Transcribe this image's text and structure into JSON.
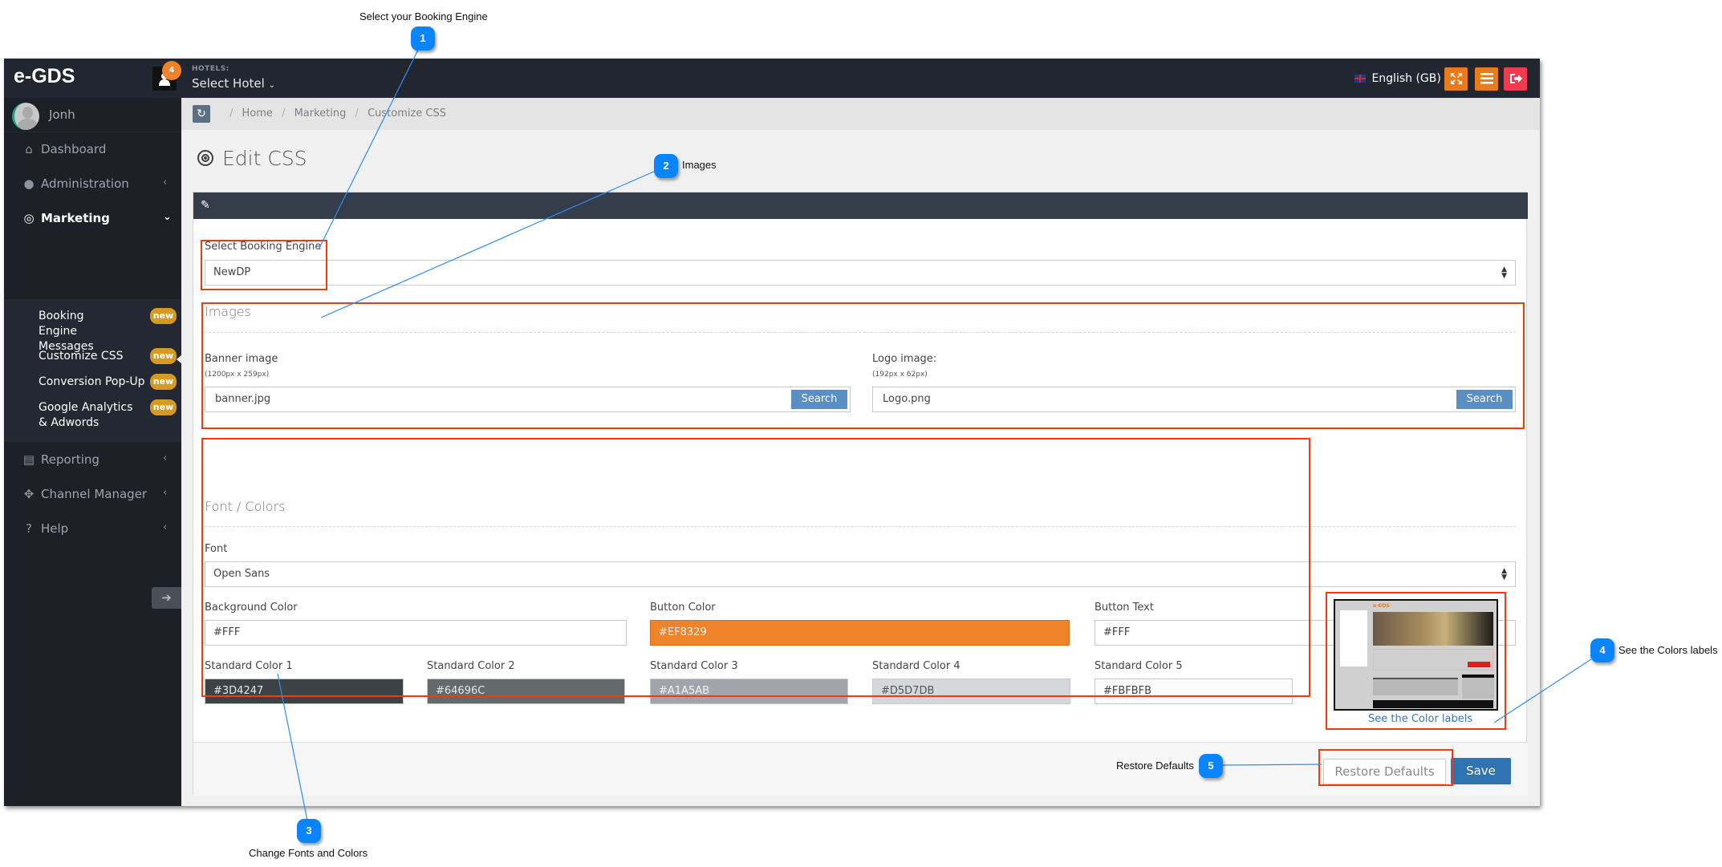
{
  "app": {
    "brand": "e-GDS",
    "notification_count": "4",
    "hotels_label": "HOTELS:",
    "hotel_select": "Select Hotel",
    "language": "English (GB)",
    "icons": {
      "fullscreen": "fullscreen-icon",
      "menu": "hamburger-icon",
      "logout": "logout-icon"
    }
  },
  "sidebar": {
    "username": "Jonh",
    "items": [
      {
        "label": "Dashboard",
        "icon": "home-icon",
        "arrow": ""
      },
      {
        "label": "Administration",
        "icon": "user-icon",
        "arrow": "‹"
      },
      {
        "label": "Marketing",
        "icon": "target-icon",
        "arrow": "⌄",
        "active": true
      },
      {
        "label": "Reporting",
        "icon": "bar-chart-icon",
        "arrow": "‹"
      },
      {
        "label": "Channel Manager",
        "icon": "move-icon",
        "arrow": "‹"
      },
      {
        "label": "Help",
        "icon": "question-icon",
        "arrow": "‹"
      }
    ],
    "submenu": [
      {
        "label": "Booking Engine Messages",
        "badge": "new"
      },
      {
        "label": "Customize CSS",
        "badge": "new",
        "active": true
      },
      {
        "label": "Conversion Pop-Up",
        "badge": "new"
      },
      {
        "label": "Google Analytics & Adwords",
        "badge": "new"
      }
    ]
  },
  "breadcrumb": [
    "Home",
    "Marketing",
    "Customize CSS"
  ],
  "page": {
    "title": "Edit CSS",
    "booking_engine": {
      "label": "Select Booking Engine",
      "value": "NewDP"
    },
    "images": {
      "title": "Images",
      "banner": {
        "label": "Banner image",
        "hint": "(1200px x 259px)",
        "value": "banner.jpg",
        "button": "Search"
      },
      "logo": {
        "label": "Logo image:",
        "hint": "(192px x 62px)",
        "value": "Logo.png",
        "button": "Search"
      }
    },
    "fonts": {
      "title": "Font / Colors",
      "font_label": "Font",
      "font_value": "Open Sans",
      "background": {
        "label": "Background Color",
        "value": "#FFF",
        "swatch": "#ffffff"
      },
      "button_color": {
        "label": "Button Color",
        "value": "#EF8329",
        "swatch": "#ef8329"
      },
      "button_text": {
        "label": "Button Text",
        "value": "#FFF",
        "swatch": "#ffffff"
      },
      "standard": [
        {
          "label": "Standard Color 1",
          "value": "#3D4247",
          "swatch": "#3d4247"
        },
        {
          "label": "Standard Color 2",
          "value": "#64696C",
          "swatch": "#64696c"
        },
        {
          "label": "Standard Color 3",
          "value": "#A1A5AB",
          "swatch": "#a1a5ab"
        },
        {
          "label": "Standard Color 4",
          "value": "#D5D7DB",
          "swatch": "#d5d7db"
        },
        {
          "label": "Standard Color 5",
          "value": "#FBFBFB",
          "swatch": "#fbfbfb"
        }
      ]
    },
    "color_labels_link": "See the Color labels",
    "restore_button": "Restore Defaults",
    "save_button": "Save"
  },
  "annotations": [
    {
      "number": "1",
      "text": "Select your Booking Engine"
    },
    {
      "number": "2",
      "text": "Images"
    },
    {
      "number": "3",
      "text": "Change Fonts and Colors"
    },
    {
      "number": "4",
      "text": "See the Colors labels"
    },
    {
      "number": "5",
      "text": "Restore Defaults"
    }
  ],
  "colors": {
    "topbar": "#222630",
    "sidebar": "#1d2027",
    "accent_orange": "#e87b1c",
    "logout_red": "#f03b4f",
    "badge": "#d69a20",
    "save_blue": "#2f73b0",
    "annotation_red": "#f23a0c",
    "callout_blue": "#0a84ff"
  }
}
